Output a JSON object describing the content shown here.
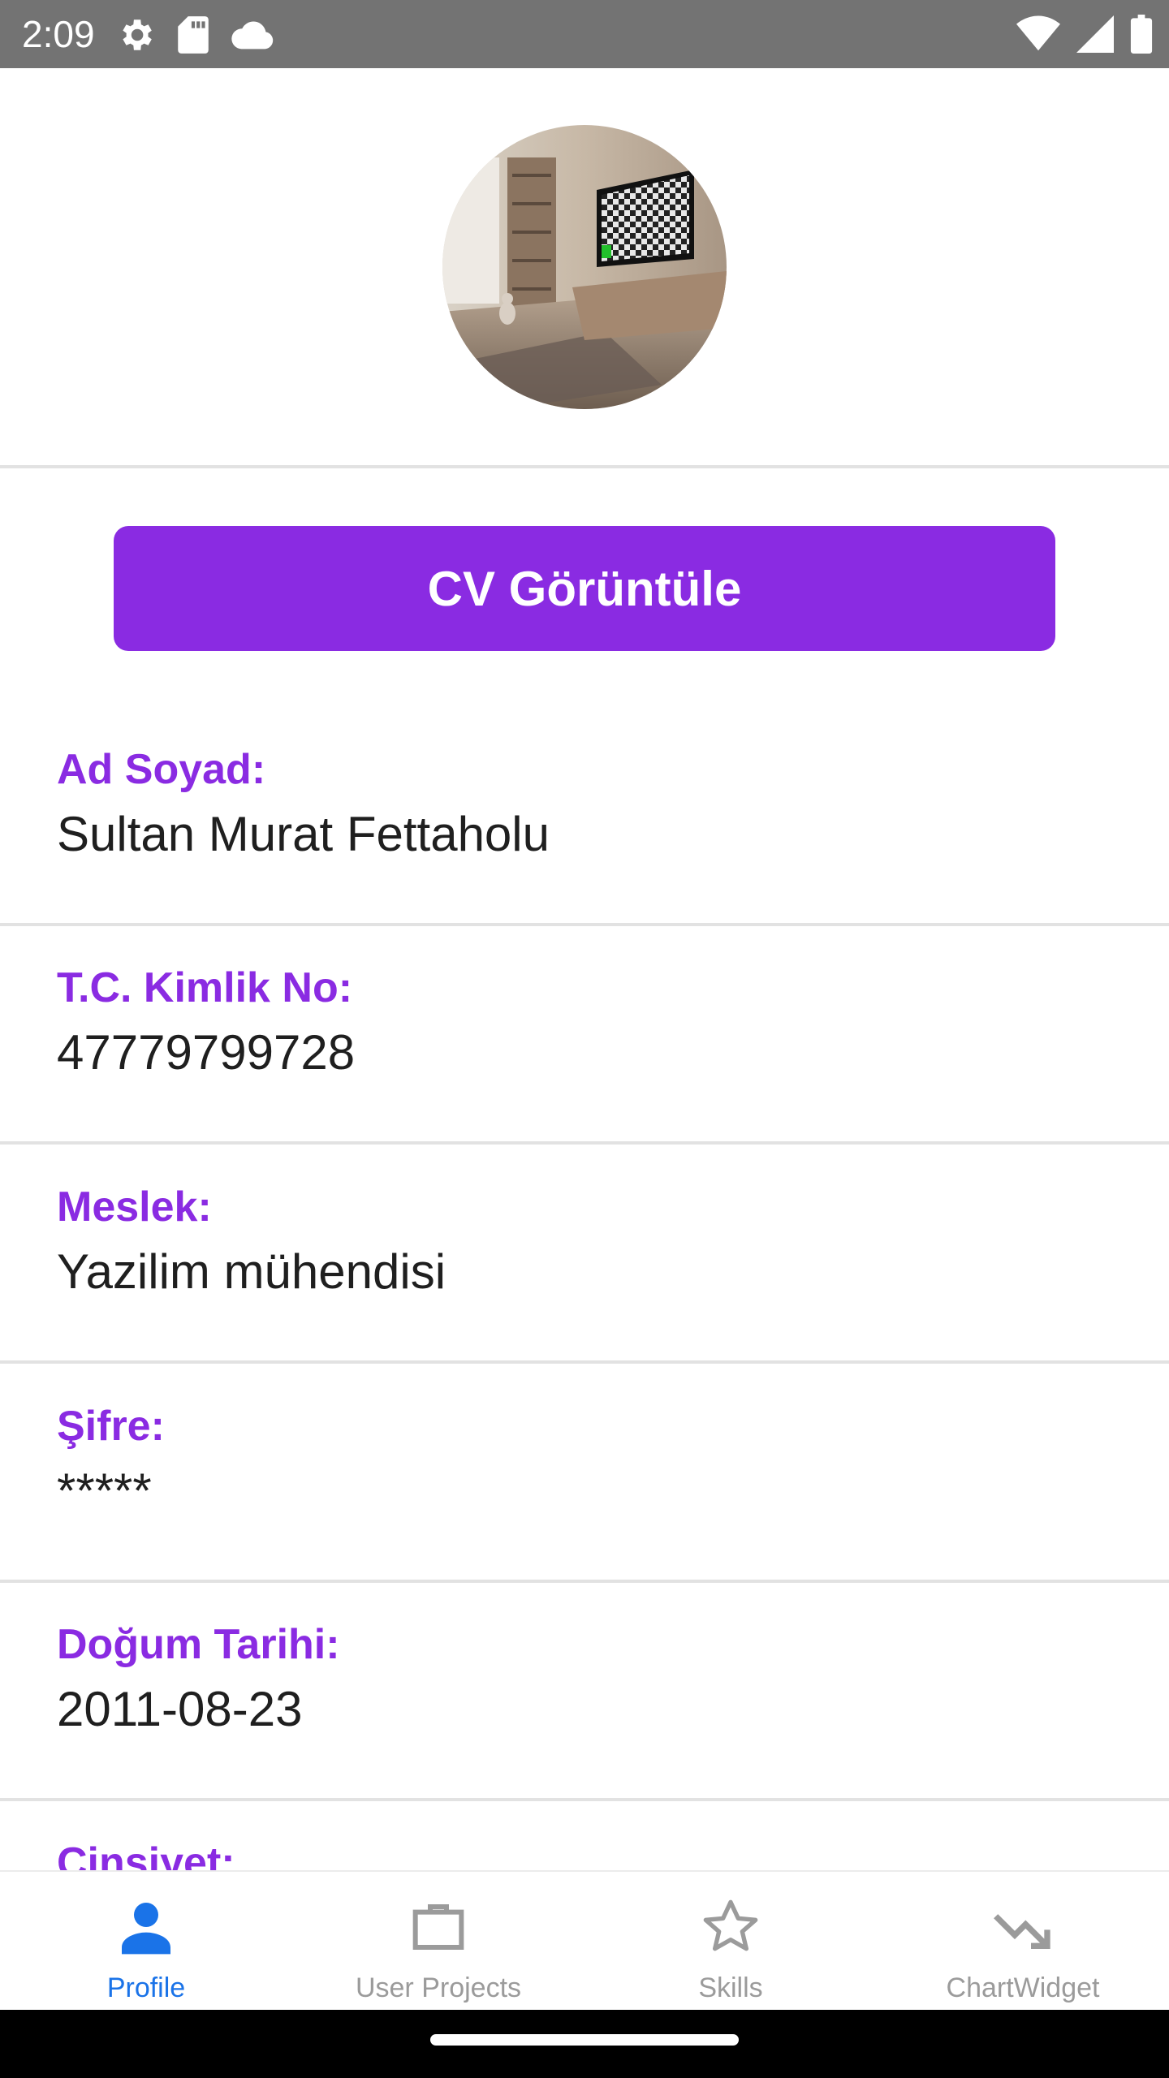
{
  "status_bar": {
    "time": "2:09",
    "left_icons": [
      "gear-icon",
      "sd-card-icon",
      "cloud-icon"
    ],
    "right_icons": [
      "wifi-icon",
      "signal-icon",
      "battery-icon"
    ]
  },
  "profile": {
    "avatar": "avatar-image"
  },
  "cv_button": {
    "label": "CV Görüntüle",
    "color": "#8a2be2"
  },
  "fields": [
    {
      "label": "Ad Soyad:",
      "value": "Sultan Murat Fettaholu"
    },
    {
      "label": "T.C. Kimlik No:",
      "value": "47779799728"
    },
    {
      "label": "Meslek:",
      "value": "Yazilim mühendisi"
    },
    {
      "label": "Şifre:",
      "value": "*****"
    },
    {
      "label": "Doğum Tarihi:",
      "value": "2011-08-23"
    },
    {
      "label": "Cinsiyet:",
      "value": ""
    }
  ],
  "bottom_nav": {
    "items": [
      {
        "label": "Profile",
        "icon": "person-icon",
        "active": true
      },
      {
        "label": "User Projects",
        "icon": "briefcase-icon",
        "active": false
      },
      {
        "label": "Skills",
        "icon": "star-icon",
        "active": false
      },
      {
        "label": "ChartWidget",
        "icon": "trending-down-icon",
        "active": false
      }
    ],
    "active_color": "#1a73e8",
    "inactive_color": "#9b9b9b"
  }
}
